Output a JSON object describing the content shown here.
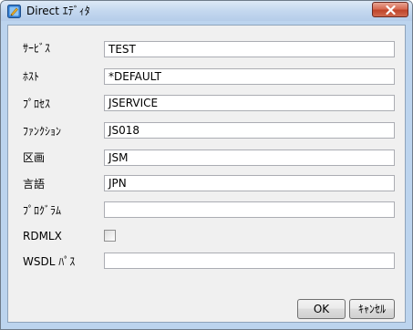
{
  "window": {
    "title": "Direct ｴﾃﾞｨﾀ",
    "icon": "app-editor-icon",
    "close_icon": "close-icon"
  },
  "form": {
    "rows": [
      {
        "label": "ｻｰﾋﾞｽ",
        "value": "TEST"
      },
      {
        "label": "ﾎｽﾄ",
        "value": "*DEFAULT"
      },
      {
        "label": "ﾌﾟﾛｾｽ",
        "value": "JSERVICE"
      },
      {
        "label": "ﾌｧﾝｸｼｮﾝ",
        "value": "JS018"
      },
      {
        "label": "区画",
        "value": "JSM"
      },
      {
        "label": "言語",
        "value": "JPN"
      },
      {
        "label": "ﾌﾟﾛｸﾞﾗﾑ",
        "value": ""
      }
    ],
    "rdmlx": {
      "label": "RDMLX",
      "checked": false
    },
    "wsdl": {
      "label": "WSDL ﾊﾟｽ",
      "value": ""
    }
  },
  "buttons": {
    "ok_label": "OK",
    "cancel_label": "ｷｬﾝｾﾙ"
  },
  "colors": {
    "frame": "#bcd4ee",
    "client_bg": "#f0f0f0",
    "close_button": "#c7503a"
  }
}
